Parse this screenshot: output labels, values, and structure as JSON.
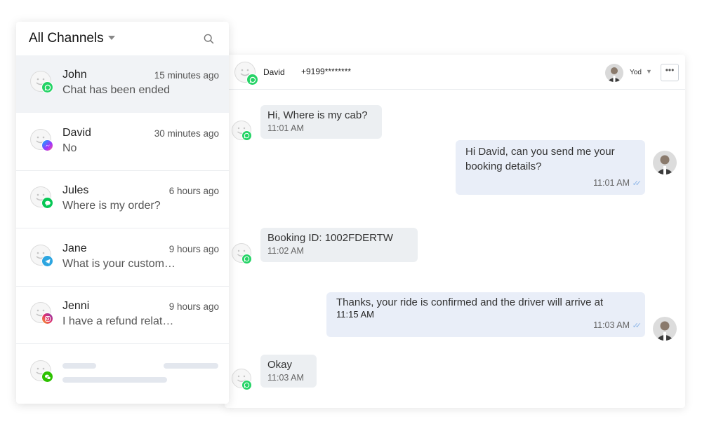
{
  "sidebar": {
    "title": "All Channels",
    "conversations": [
      {
        "name": "John",
        "time": "15 minutes ago",
        "message": "Chat has been ended",
        "channel": "whatsapp",
        "active": true
      },
      {
        "name": "David",
        "time": "30 minutes ago",
        "message": "No",
        "channel": "messenger",
        "active": false
      },
      {
        "name": "Jules",
        "time": "6 hours ago",
        "message": "Where is my order?",
        "channel": "line",
        "active": false
      },
      {
        "name": "Jane",
        "time": "9 hours ago",
        "message": "What is your custom…",
        "channel": "telegram",
        "active": false
      },
      {
        "name": "Jenni",
        "time": "9 hours ago",
        "message": "I have a refund relat…",
        "channel": "instagram",
        "active": false
      },
      {
        "name": "",
        "time": "",
        "message": "",
        "channel": "wechat",
        "active": false
      }
    ]
  },
  "chat": {
    "contact_name": "David",
    "contact_phone": "+9199********",
    "agent_name": "Yod",
    "channel": "whatsapp",
    "messages": [
      {
        "direction": "in",
        "text": "Hi, Where is my cab?",
        "time": "11:01 AM"
      },
      {
        "direction": "out",
        "text_line1": "Hi David, can you send me your",
        "text_line2": "booking details?",
        "time": "11:01 AM"
      },
      {
        "direction": "in",
        "text": "Booking ID: 1002FDERTW",
        "time": "11:02 AM"
      },
      {
        "direction": "out",
        "text_line1": "Thanks, your ride is confirmed and the driver will arrive at",
        "text_line2": "11:15 AM",
        "time": "11:03 AM"
      },
      {
        "direction": "in",
        "text": "Okay",
        "time": "11:03 AM"
      }
    ]
  },
  "colors": {
    "whatsapp": "#25d366",
    "telegram": "#2ca5e0",
    "line": "#06c755",
    "wechat": "#2dc100",
    "accent_ticks": "#8fb7e8"
  }
}
